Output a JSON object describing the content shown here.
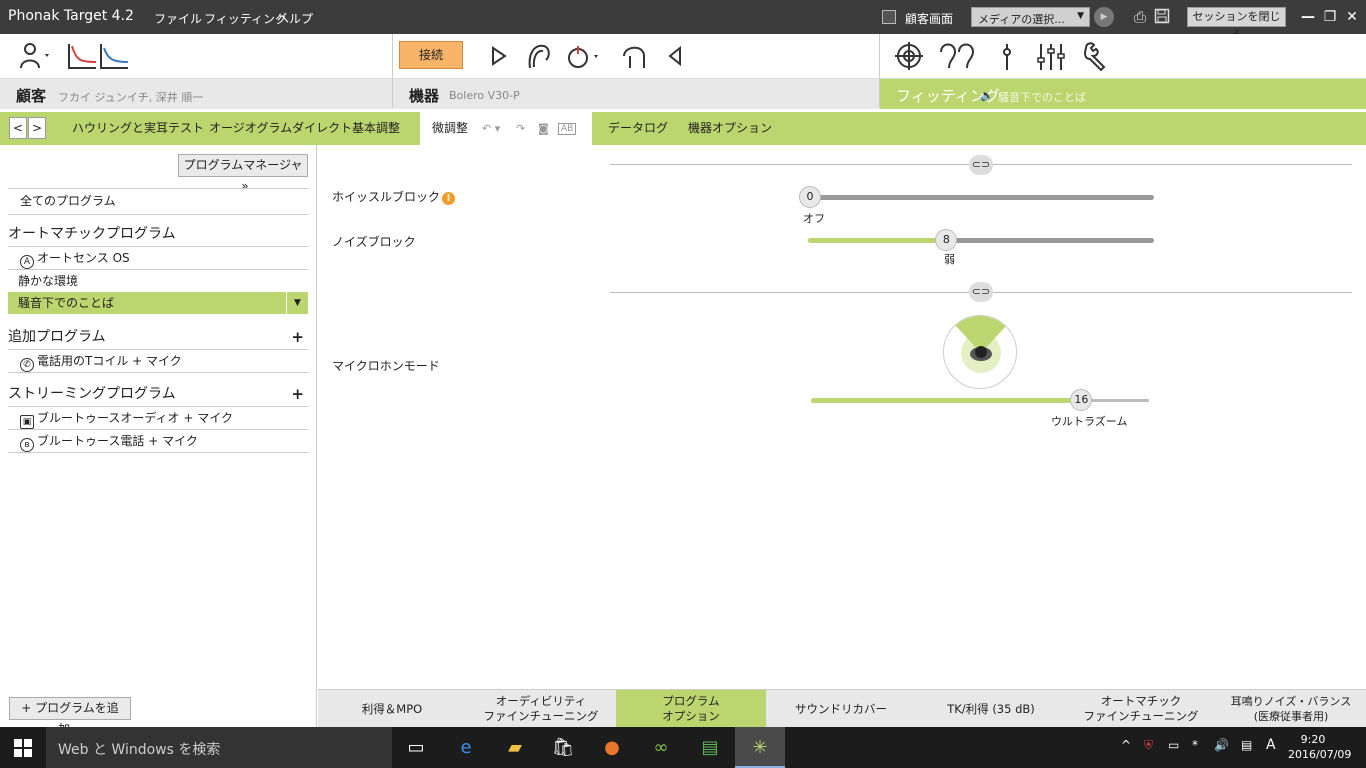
{
  "titlebar": {
    "app_title": "Phonak Target 4.2",
    "menu": [
      "ファイル",
      "フィッティング",
      "ヘルプ"
    ],
    "customer_screen_label": "顧客画面",
    "media_select": "メディアの選択...",
    "close_session": "セッションを閉じる"
  },
  "toolbar": {
    "connect_label": "接続"
  },
  "sections": {
    "client": {
      "title": "顧客",
      "subtitle": "フカイ ジュンイチ, 深井 順一"
    },
    "device": {
      "title": "機器",
      "subtitle": "Bolero V30-P"
    },
    "fitting": {
      "title": "フィッティング",
      "subtitle": "騒音下でのことば"
    }
  },
  "tabs": [
    {
      "label": "ハウリングと実耳テスト"
    },
    {
      "label": "オージオグラムダイレクト"
    },
    {
      "label": "基本調整"
    },
    {
      "label": "微調整",
      "active": true
    },
    {
      "label": "データログ"
    },
    {
      "label": "機器オプション"
    }
  ],
  "left_panel": {
    "program_manager": "プログラムマネージャ",
    "all_programs": "全てのプログラム",
    "auto_group": "オートマチックプログラム",
    "auto_items": [
      "オートセンス OS",
      "静かな環境",
      "騒音下でのことば"
    ],
    "selected_program": "騒音下でのことば",
    "additional_group": "追加プログラム",
    "additional_items": [
      "電話用のTコイル + マイク"
    ],
    "streaming_group": "ストリーミングプログラム",
    "streaming_items": [
      "ブルートゥースオーディオ + マイク",
      "ブルートゥース電話 + マイク"
    ],
    "add_program": "プログラムを追加..."
  },
  "main": {
    "whistle_block": {
      "label": "ホイッスルブロック",
      "value": "0",
      "caption": "オフ",
      "fraction": 0.0
    },
    "noise_block": {
      "label": "ノイズブロック",
      "value": "8",
      "caption": "弱",
      "fraction": 0.4
    },
    "mic_mode": {
      "label": "マイクロホンモード",
      "value": "16",
      "caption": "ウルトラズーム",
      "fraction": 0.8
    }
  },
  "bottom_tabs": [
    {
      "label": "利得＆MPO"
    },
    {
      "label": "オーディビリティ\nファインチューニング"
    },
    {
      "label": "プログラム\nオプション",
      "active": true
    },
    {
      "label": "サウンドリカバー"
    },
    {
      "label": "TK/利得 (35 dB)"
    },
    {
      "label": "オートマチック\nファインチューニング"
    },
    {
      "label": "耳鳴りノイズ・バランス\n(医療従事者用)"
    }
  ],
  "taskbar": {
    "search_placeholder": "Web と Windows を検索",
    "ime": "A",
    "time": "9:20",
    "date": "2016/07/09"
  },
  "colors": {
    "accent_green": "#bcd66f",
    "connect_orange": "#f8b56a",
    "warning": "#f39c2b"
  }
}
